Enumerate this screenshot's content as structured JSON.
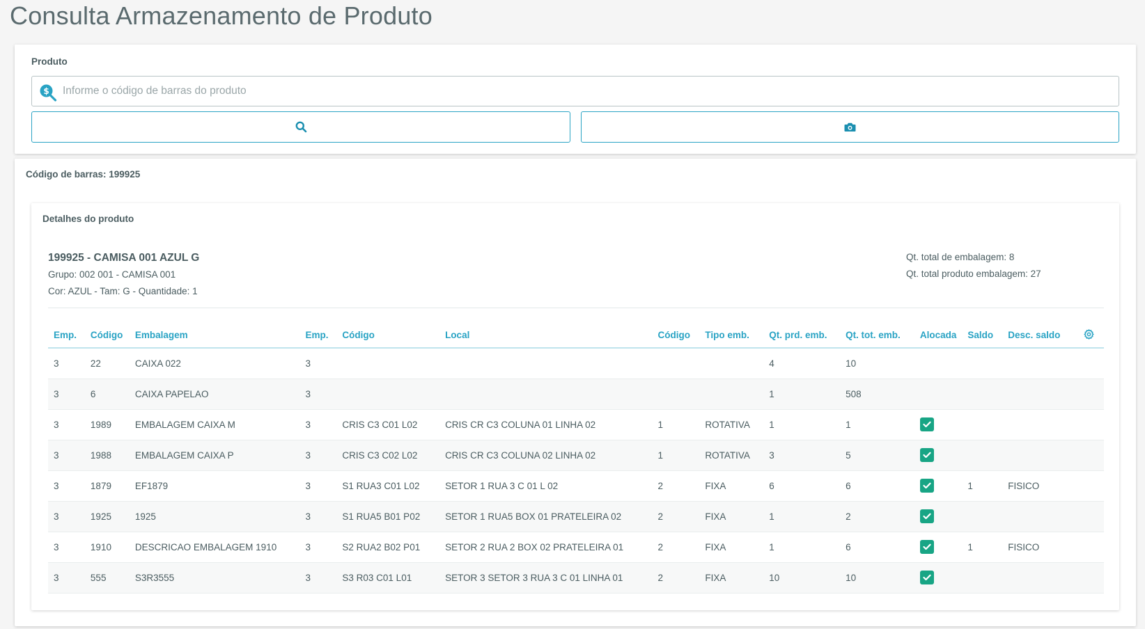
{
  "page": {
    "title": "Consulta Armazenamento de Produto"
  },
  "search": {
    "label": "Produto",
    "placeholder": "Informe o código de barras do produto",
    "value": "",
    "search_button_icon": "search-icon",
    "camera_button_icon": "camera-icon",
    "accent_color": "#29a3c4"
  },
  "result": {
    "barcode_text": "Código de barras: 199925",
    "details_title": "Detalhes do produto",
    "product_name": "199925 - CAMISA 001 AZUL G",
    "product_group": "Grupo: 002 001 - CAMISA 001",
    "product_attrs": "Cor: AZUL - Tam: G - Quantidade: 1",
    "total_packaging": "Qt. total de embalagem: 8",
    "total_product_packaging": "Qt. total produto embalagem: 27"
  },
  "table": {
    "columns": [
      "Emp.",
      "Código",
      "Embalagem",
      "Emp.",
      "Código",
      "Local",
      "Código",
      "Tipo emb.",
      "Qt. prd. emb.",
      "Qt. tot. emb.",
      "Alocada",
      "Saldo",
      "Desc. saldo"
    ],
    "settings_icon": "gear-icon",
    "rows": [
      {
        "c0": "3",
        "c1": "22",
        "c2": "CAIXA 022",
        "c3": "3",
        "c4": "",
        "c5": "",
        "c6": "",
        "c7": "",
        "c8": "4",
        "c9": "10",
        "alocada": false,
        "c11": "",
        "c12": ""
      },
      {
        "c0": "3",
        "c1": "6",
        "c2": "CAIXA PAPELAO",
        "c3": "3",
        "c4": "",
        "c5": "",
        "c6": "",
        "c7": "",
        "c8": "1",
        "c9": "508",
        "alocada": false,
        "c11": "",
        "c12": ""
      },
      {
        "c0": "3",
        "c1": "1989",
        "c2": "EMBALAGEM CAIXA M",
        "c3": "3",
        "c4": "CRIS C3 C01 L02",
        "c5": "CRIS CR C3 COLUNA 01 LINHA 02",
        "c6": "1",
        "c7": "ROTATIVA",
        "c8": "1",
        "c9": "1",
        "alocada": true,
        "c11": "",
        "c12": ""
      },
      {
        "c0": "3",
        "c1": "1988",
        "c2": "EMBALAGEM CAIXA P",
        "c3": "3",
        "c4": "CRIS C3 C02 L02",
        "c5": "CRIS CR C3 COLUNA 02 LINHA 02",
        "c6": "1",
        "c7": "ROTATIVA",
        "c8": "3",
        "c9": "5",
        "alocada": true,
        "c11": "",
        "c12": ""
      },
      {
        "c0": "3",
        "c1": "1879",
        "c2": "EF1879",
        "c3": "3",
        "c4": "S1 RUA3 C01 L02",
        "c5": "SETOR 1 RUA 3 C 01 L 02",
        "c6": "2",
        "c7": "FIXA",
        "c8": "6",
        "c9": "6",
        "alocada": true,
        "c11": "1",
        "c12": "FISICO"
      },
      {
        "c0": "3",
        "c1": "1925",
        "c2": "1925",
        "c3": "3",
        "c4": "S1 RUA5 B01 P02",
        "c5": "SETOR 1 RUA5 BOX 01 PRATELEIRA 02",
        "c6": "2",
        "c7": "FIXA",
        "c8": "1",
        "c9": "2",
        "alocada": true,
        "c11": "",
        "c12": ""
      },
      {
        "c0": "3",
        "c1": "1910",
        "c2": "DESCRICAO EMBALAGEM 1910",
        "c3": "3",
        "c4": "S2 RUA2 B02 P01",
        "c5": "SETOR 2 RUA 2 BOX 02 PRATELEIRA 01",
        "c6": "2",
        "c7": "FIXA",
        "c8": "1",
        "c9": "6",
        "alocada": true,
        "c11": "1",
        "c12": "FISICO"
      },
      {
        "c0": "3",
        "c1": "555",
        "c2": "S3R3555",
        "c3": "3",
        "c4": "S3 R03 C01 L01",
        "c5": "SETOR 3 SETOR 3 RUA 3 C 01 LINHA 01",
        "c6": "2",
        "c7": "FIXA",
        "c8": "10",
        "c9": "10",
        "alocada": true,
        "c11": "",
        "c12": ""
      }
    ],
    "check_color": "#18a585"
  }
}
